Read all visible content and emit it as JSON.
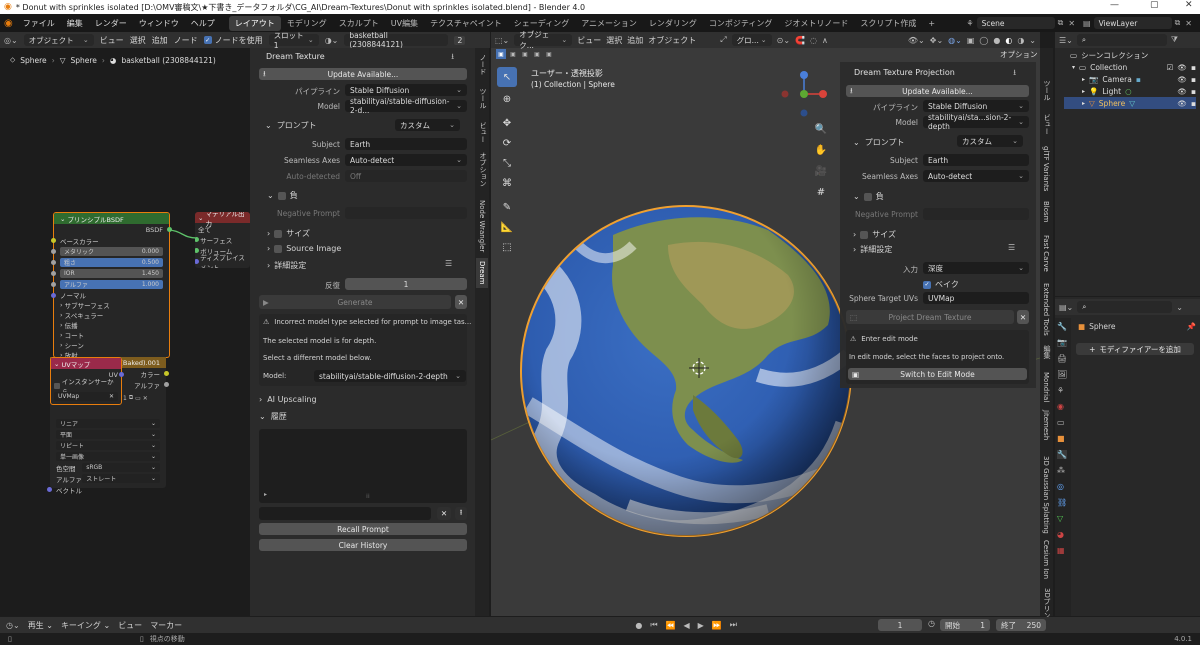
{
  "window": {
    "title": "* Donut with sprinkles isolated [D:\\OMV審稿文\\★下書き_データフォルダ\\CG_AI\\Dream-Textures\\Donut with sprinkles isolated.blend] - Blender 4.0"
  },
  "menu": {
    "items": [
      "ファイル",
      "編集",
      "レンダー",
      "ウィンドウ",
      "ヘルプ"
    ]
  },
  "workspaces": [
    "レイアウト",
    "モデリング",
    "スカルプト",
    "UV編集",
    "テクスチャペイント",
    "シェーディング",
    "アニメーション",
    "レンダリング",
    "コンポジティング",
    "ジオメトリノード",
    "スクリプト作成"
  ],
  "scene": {
    "name": "Scene",
    "viewlayer": "ViewLayer"
  },
  "node_header": {
    "mode": "オブジェクト",
    "menus": [
      "ビュー",
      "選択",
      "追加",
      "ノード"
    ],
    "use_nodes": "ノードを使用",
    "slot": "スロット1",
    "material": "basketball (2308844121)",
    "users": "2"
  },
  "breadcrumb": {
    "obj": "Sphere",
    "mesh": "Sphere",
    "mat": "basketball (2308844121)"
  },
  "nodes": {
    "bsdf": {
      "title": "プリンシプルBSDF",
      "out": "BSDF",
      "base_color": "ベースカラー",
      "rows": [
        {
          "label": "メタリック",
          "value": "0.000"
        },
        {
          "label": "粗さ",
          "value": "0.500"
        },
        {
          "label": "IOR",
          "value": "1.450"
        },
        {
          "label": "アルファ",
          "value": "1.000"
        }
      ],
      "more": [
        "ノーマル",
        "サブサーフェス",
        "スペキュラー",
        "伝播",
        "コート",
        "シーン",
        "放射"
      ]
    },
    "output": {
      "title": "マテリアル出力",
      "target": "全て",
      "rows": [
        "サーフェス",
        "ボリューム",
        "ディスプレイスメント"
      ]
    },
    "uvmap": {
      "title": "UVマップ",
      "out": "UV",
      "instancer": "インスタンサーから",
      "uv": "UVMap"
    },
    "image": {
      "title": "1).(Baked).001",
      "outs": [
        "カラー",
        "アルファ"
      ],
      "interp": "リニア",
      "proj": "平面",
      "ext": "リピート",
      "single": "単一画像",
      "cs_label": "色空間",
      "cs": "sRGB",
      "alpha_label": "アルファ",
      "alpha": "ストレート",
      "vec": "ベクトル"
    }
  },
  "side_tabs_left": [
    "ノード",
    "ツール",
    "ビュー",
    "オプション",
    "Node Wrangler",
    "Dream"
  ],
  "dream": {
    "title": "Dream Texture",
    "update": "Update Available...",
    "pipeline_label": "パイプライン",
    "pipeline": "Stable Diffusion",
    "model_label": "Model",
    "model": "stabilityai/stable-diffusion-2-d...",
    "prompt": "プロンプト",
    "prompt_mode": "カスタム",
    "subject_label": "Subject",
    "subject": "Earth",
    "seamless_label": "Seamless Axes",
    "seamless": "Auto-detect",
    "autodet_label": "Auto-detected",
    "autodet": "Off",
    "negative": "負",
    "neg_label": "Negative Prompt",
    "size": "サイズ",
    "source": "Source Image",
    "advanced": "詳細設定",
    "iter_label": "反復",
    "iter": "1",
    "generate": "Generate",
    "warn1": "Incorrect model type selected for prompt to image tas...",
    "warn2": "The selected model is for depth.",
    "warn3": "Select a different model below.",
    "wmodel_label": "Model:",
    "wmodel": "stabilityai/stable-diffusion-2-depth",
    "upscale": "AI Upscaling",
    "history": "履歴",
    "recall": "Recall Prompt",
    "clear": "Clear History"
  },
  "viewport": {
    "header": {
      "mode": "オブジェク...",
      "menus": [
        "ビュー",
        "選択",
        "追加",
        "オブジェクト"
      ],
      "orient": "グロ...",
      "options": "オプション"
    },
    "overlay1": "ユーザー・透視投影",
    "overlay2": "(1) Collection | Sphere"
  },
  "project": {
    "title": "Dream Texture Projection",
    "update": "Update Available...",
    "pipeline_label": "パイプライン",
    "pipeline": "Stable Diffusion",
    "model_label": "Model",
    "model": "stabilityai/sta...sion-2-depth",
    "prompt": "プロンプト",
    "prompt_mode": "カスタム",
    "subject_label": "Subject",
    "subject": "Earth",
    "seamless_label": "Seamless Axes",
    "seamless": "Auto-detect",
    "negative": "負",
    "neg_label": "Negative Prompt",
    "size": "サイズ",
    "advanced": "詳細設定",
    "input_label": "入力",
    "input": "深度",
    "bake": "ベイク",
    "uvs_label": "Sphere Target UVs",
    "uvs": "UVMap",
    "project_btn": "Project Dream Texture",
    "edit1": "Enter edit mode",
    "edit2": "In edit mode, select the faces to project onto.",
    "switch": "Switch to Edit Mode"
  },
  "side_tabs_right": [
    "ツール",
    "ビュー",
    "glTF Variants",
    "Blosm",
    "Fast Carve",
    "Extended Tools",
    "編集",
    "Mondrial",
    "Jitemesh",
    "3D Gaussian Splatting",
    "Cesium Ion",
    "3Dプリント"
  ],
  "outliner": {
    "scene_collection": "シーンコレクション",
    "items": [
      {
        "name": "Collection"
      },
      {
        "name": "Camera"
      },
      {
        "name": "Light"
      },
      {
        "name": "Sphere"
      }
    ]
  },
  "properties": {
    "object": "Sphere",
    "add_modifier": "モディファイアーを追加"
  },
  "timeline": {
    "menus": [
      "再生",
      "キーイング",
      "ビュー",
      "マーカー"
    ],
    "frame": "1",
    "start_label": "開始",
    "start": "1",
    "end_label": "終了",
    "end": "250"
  },
  "status": {
    "hint": "視点の移動",
    "version": "4.0.1"
  },
  "colors": {
    "accent": "#4772b3",
    "bsdf_header": "#2f6b2f",
    "output_header": "#7a2a2a",
    "uv_header": "#9a2a4a",
    "image_header": "#7d5c1e"
  }
}
